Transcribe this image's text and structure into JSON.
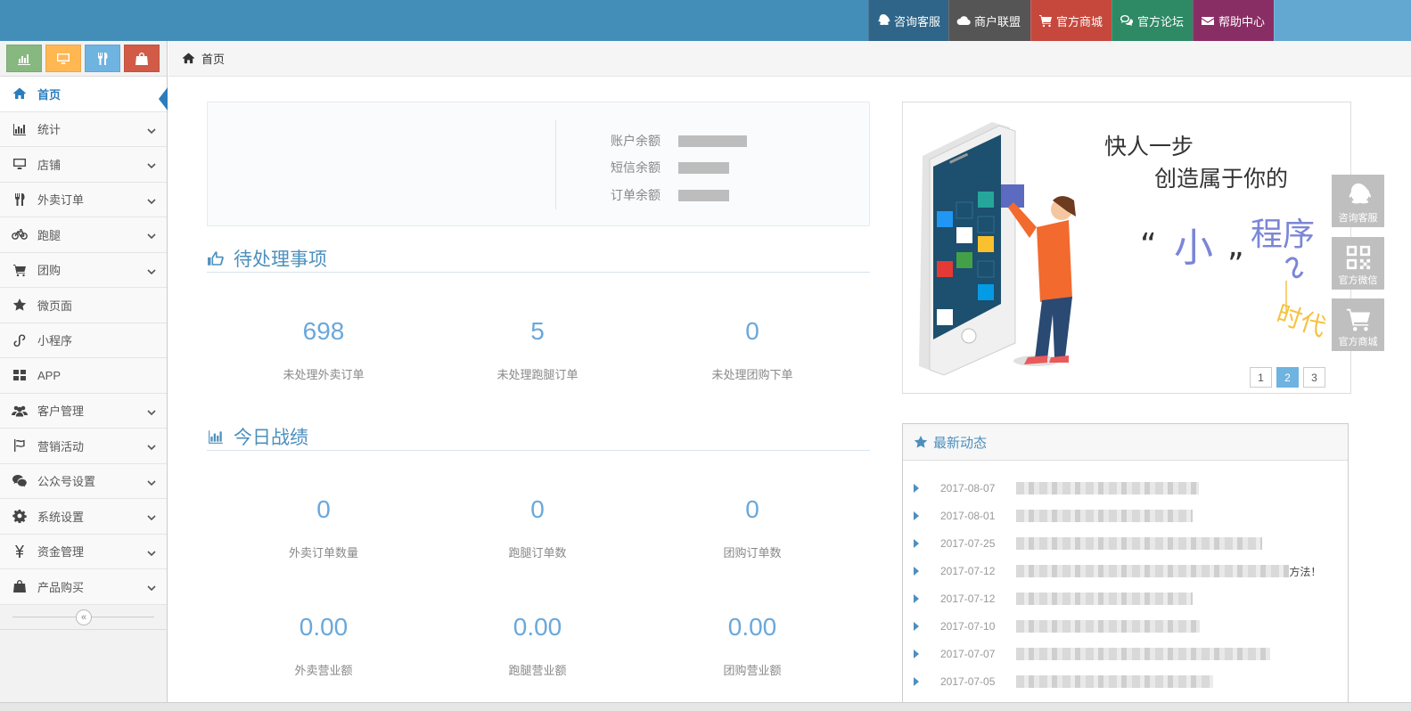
{
  "topnav": {
    "items": [
      {
        "label": "咨询客服",
        "icon": "qq-icon"
      },
      {
        "label": "商户联盟",
        "icon": "cloud-icon"
      },
      {
        "label": "官方商城",
        "icon": "cart-icon"
      },
      {
        "label": "官方论坛",
        "icon": "comments-icon"
      },
      {
        "label": "帮助中心",
        "icon": "envelope-icon"
      }
    ]
  },
  "sidebar": {
    "shortcuts": [
      "bar-chart-icon",
      "desktop-icon",
      "cutlery-icon",
      "shopping-bag-icon"
    ],
    "items": [
      {
        "label": "首页",
        "icon": "home-icon",
        "active": true
      },
      {
        "label": "统计",
        "icon": "bar-chart-icon"
      },
      {
        "label": "店铺",
        "icon": "desktop-icon"
      },
      {
        "label": "外卖订单",
        "icon": "cutlery-icon"
      },
      {
        "label": "跑腿",
        "icon": "bicycle-icon"
      },
      {
        "label": "团购",
        "icon": "cart-plus-icon"
      },
      {
        "label": "微页面",
        "icon": "star-icon"
      },
      {
        "label": "小程序",
        "icon": "miniprogram-icon"
      },
      {
        "label": "APP",
        "icon": "grid-icon"
      },
      {
        "label": "客户管理",
        "icon": "users-icon"
      },
      {
        "label": "营销活动",
        "icon": "flag-icon"
      },
      {
        "label": "公众号设置",
        "icon": "wechat-icon"
      },
      {
        "label": "系统设置",
        "icon": "gear-icon"
      },
      {
        "label": "资金管理",
        "icon": "yen-icon"
      },
      {
        "label": "产品购买",
        "icon": "shopping-bag-icon"
      }
    ],
    "collapse_glyph": "«"
  },
  "breadcrumb": {
    "home": "首页"
  },
  "account": {
    "rows": [
      {
        "label": "账户余额"
      },
      {
        "label": "短信余额"
      },
      {
        "label": "订单余额"
      }
    ]
  },
  "pending": {
    "title": "待处理事项",
    "stats": [
      {
        "value": "698",
        "label": "未处理外卖订单"
      },
      {
        "value": "5",
        "label": "未处理跑腿订单"
      },
      {
        "value": "0",
        "label": "未处理团购下单"
      }
    ]
  },
  "today": {
    "title": "今日战绩",
    "counts": [
      {
        "value": "0",
        "label": "外卖订单数量"
      },
      {
        "value": "0",
        "label": "跑腿订单数"
      },
      {
        "value": "0",
        "label": "团购订单数"
      }
    ],
    "revenue": [
      {
        "value": "0.00",
        "label": "外卖营业额"
      },
      {
        "value": "0.00",
        "label": "跑腿营业额"
      },
      {
        "value": "0.00",
        "label": "团购营业额"
      }
    ]
  },
  "banner": {
    "line1": "快人一步",
    "line2": "创造属于你的",
    "q_open": "“",
    "small": "小",
    "q_close": "”",
    "program": "程序",
    "era": "时代",
    "pages": [
      "1",
      "2",
      "3"
    ],
    "current_page": "2"
  },
  "news": {
    "title": "最新动态",
    "items": [
      {
        "date": "2017-08-07",
        "tail": ""
      },
      {
        "date": "2017-08-01",
        "tail": ""
      },
      {
        "date": "2017-07-25",
        "tail": ""
      },
      {
        "date": "2017-07-12",
        "tail": "方法！"
      },
      {
        "date": "2017-07-12",
        "tail": ""
      },
      {
        "date": "2017-07-10",
        "tail": ""
      },
      {
        "date": "2017-07-07",
        "tail": ""
      },
      {
        "date": "2017-07-05",
        "tail": ""
      }
    ]
  },
  "floating": [
    {
      "label": "咨询客服",
      "icon": "qq-icon"
    },
    {
      "label": "官方微信",
      "icon": "qrcode-icon"
    },
    {
      "label": "官方商城",
      "icon": "cart-icon"
    }
  ],
  "colors": {
    "topbar": "#438eb9",
    "accent": "#4c8fbd",
    "stat_number": "#6aa8db"
  }
}
